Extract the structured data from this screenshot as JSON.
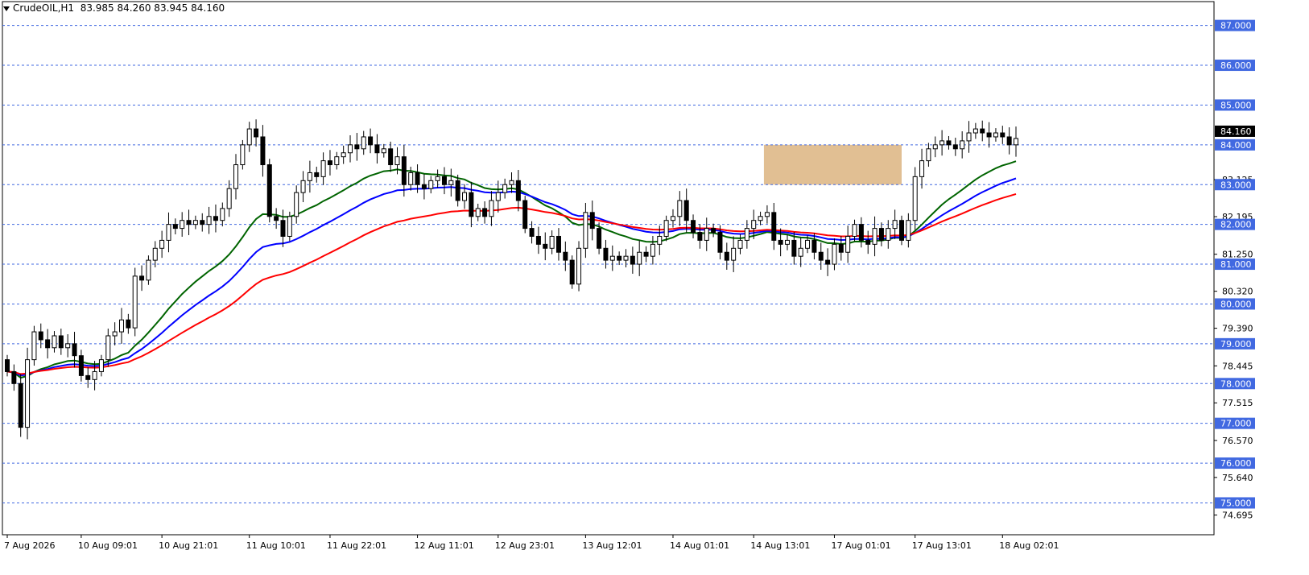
{
  "window": {
    "symbol": "CrudeOIL,H1",
    "ohlc": "83.985 84.260 83.945 84.160"
  },
  "colors": {
    "bull": "#ffffff",
    "bear": "#000000",
    "ema_fast": "#006400",
    "ema_mid": "#0000ff",
    "ema_slow": "#ff0000",
    "zone_fill": "#deb887",
    "level_line": "#4169e1",
    "level_label_bg": "#4169e1",
    "current_price_bg": "#000000"
  },
  "chart_data": {
    "type": "candlestick",
    "ylim": [
      74.2,
      87.6
    ],
    "current_price": "84.160",
    "axis_ticks": [
      "83.125",
      "82.195",
      "81.250",
      "80.320",
      "79.390",
      "78.445",
      "77.515",
      "76.570",
      "75.640",
      "74.695"
    ],
    "levels": [
      "87.000",
      "86.000",
      "85.000",
      "84.000",
      "83.000",
      "82.000",
      "81.000",
      "80.000",
      "79.000",
      "78.000",
      "77.000",
      "76.000",
      "75.000"
    ],
    "zone": {
      "from_index": 113,
      "to_index": 133,
      "low": 83.0,
      "high": 84.0
    },
    "x_labels": [
      {
        "label": "7 Aug 2026",
        "index": 0
      },
      {
        "label": "10 Aug 09:01",
        "index": 11
      },
      {
        "label": "10 Aug 21:01",
        "index": 23
      },
      {
        "label": "11 Aug 10:01",
        "index": 36
      },
      {
        "label": "11 Aug 22:01",
        "index": 48
      },
      {
        "label": "12 Aug 11:01",
        "index": 61
      },
      {
        "label": "12 Aug 23:01",
        "index": 73
      },
      {
        "label": "13 Aug 12:01",
        "index": 86
      },
      {
        "label": "14 Aug 01:01",
        "index": 99
      },
      {
        "label": "14 Aug 13:01",
        "index": 111
      },
      {
        "label": "17 Aug 01:01",
        "index": 123
      },
      {
        "label": "17 Aug 13:01",
        "index": 135
      },
      {
        "label": "18 Aug 02:01",
        "index": 148
      }
    ],
    "closes": [
      78.3,
      78.0,
      76.9,
      78.6,
      79.3,
      79.1,
      78.9,
      79.2,
      78.9,
      79.0,
      78.7,
      78.2,
      78.1,
      78.3,
      78.6,
      79.2,
      79.3,
      79.6,
      79.4,
      80.7,
      80.6,
      81.1,
      81.4,
      81.6,
      82.0,
      81.9,
      82.1,
      82.0,
      82.1,
      82.0,
      82.2,
      82.1,
      82.4,
      82.9,
      83.5,
      84.0,
      84.4,
      84.2,
      83.5,
      82.2,
      82.1,
      81.7,
      82.2,
      82.8,
      83.1,
      83.3,
      83.2,
      83.6,
      83.5,
      83.7,
      83.8,
      84.0,
      83.9,
      84.2,
      84.0,
      83.8,
      83.9,
      83.5,
      83.7,
      83.0,
      83.3,
      83.0,
      82.9,
      83.1,
      83.2,
      83.0,
      83.1,
      82.6,
      82.8,
      82.2,
      82.4,
      82.2,
      82.6,
      82.8,
      83.0,
      83.1,
      82.6,
      81.9,
      81.7,
      81.5,
      81.4,
      81.7,
      81.3,
      81.1,
      80.5,
      81.4,
      82.3,
      81.9,
      81.4,
      81.1,
      81.2,
      81.1,
      81.2,
      81.0,
      81.3,
      81.2,
      81.5,
      81.7,
      82.1,
      82.2,
      82.6,
      82.1,
      81.8,
      81.6,
      81.9,
      81.8,
      81.3,
      81.1,
      81.4,
      81.6,
      81.9,
      82.1,
      82.2,
      82.3,
      81.6,
      81.5,
      81.6,
      81.2,
      81.4,
      81.6,
      81.3,
      81.1,
      81.0,
      81.5,
      81.3,
      81.7,
      82.0,
      81.6,
      81.5,
      81.9,
      81.6,
      81.9,
      82.1,
      81.6,
      82.1,
      83.2,
      83.6,
      83.9,
      84.0,
      84.1,
      84.0,
      83.9,
      84.1,
      84.3,
      84.4,
      84.3,
      84.2,
      84.3,
      84.2,
      84.0,
      84.16
    ],
    "series": [
      {
        "key": "ema_fast",
        "period": 21
      },
      {
        "key": "ema_mid",
        "period": 34
      },
      {
        "key": "ema_slow",
        "period": 55
      }
    ]
  }
}
